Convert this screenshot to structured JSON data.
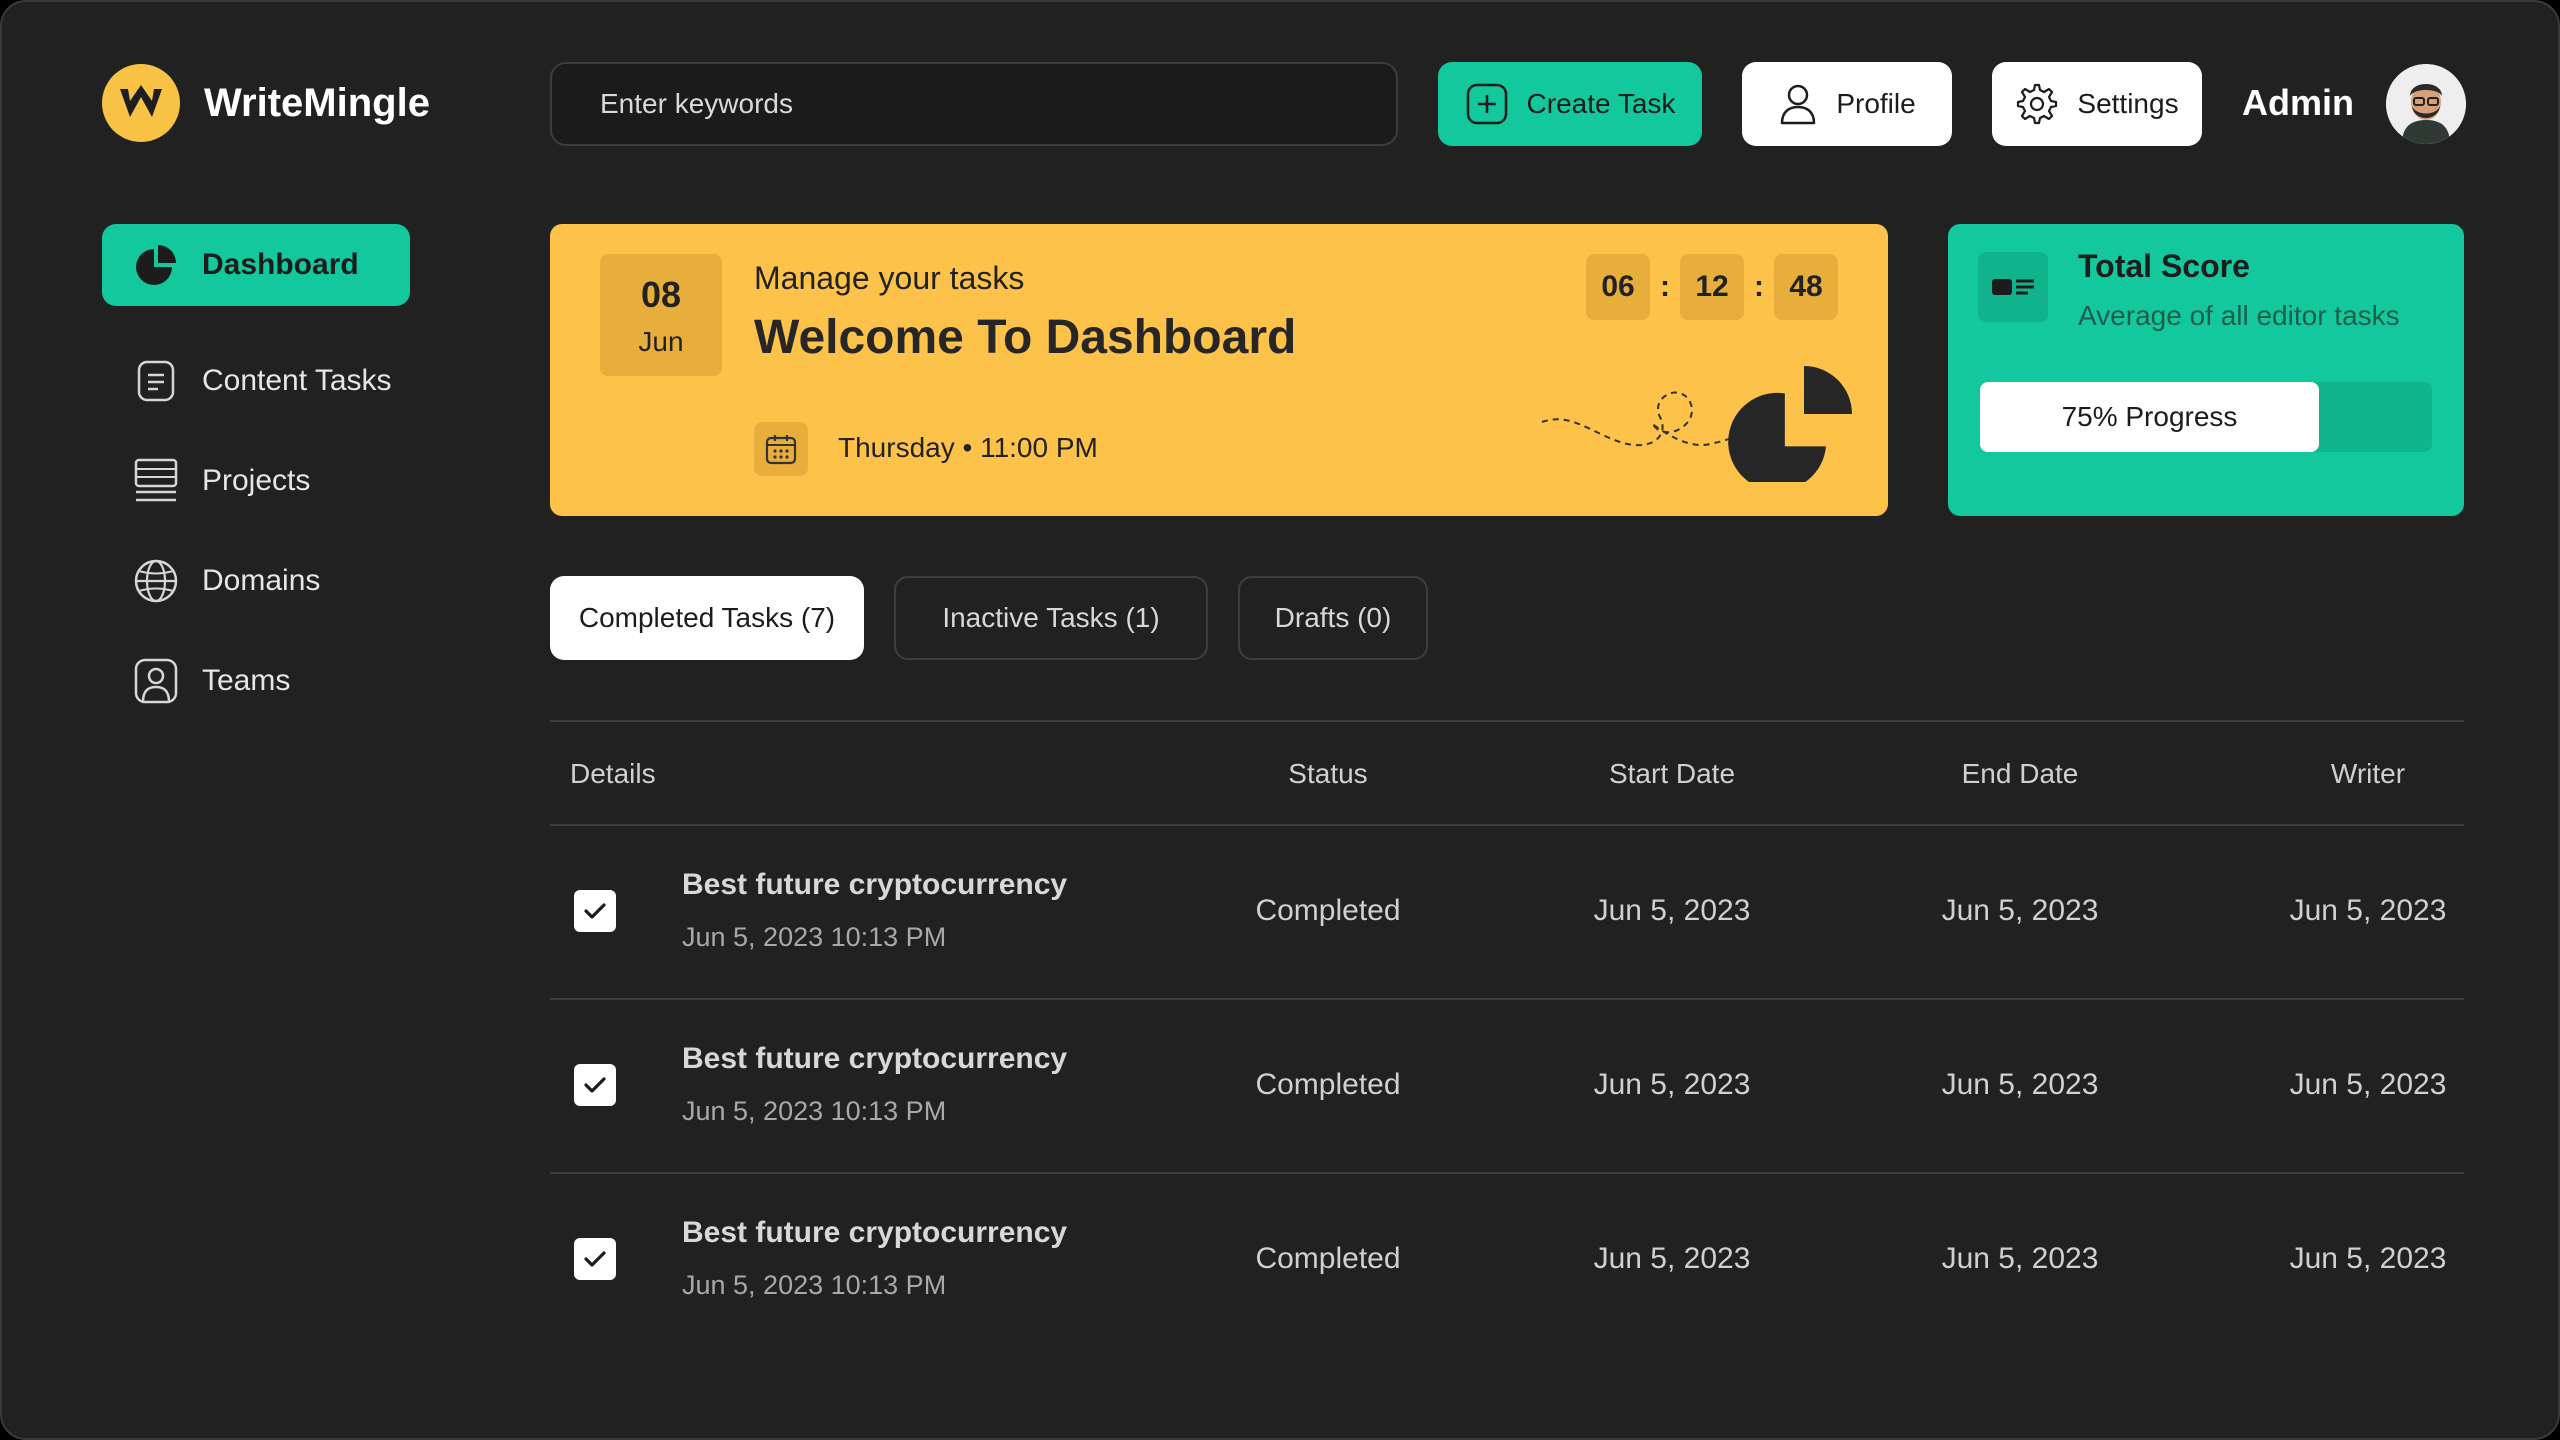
{
  "app": {
    "name": "WriteMingle"
  },
  "search": {
    "placeholder": "Enter keywords"
  },
  "header": {
    "create_label": "Create Task",
    "profile_label": "Profile",
    "settings_label": "Settings",
    "user_name": "Admin"
  },
  "sidebar": {
    "items": [
      {
        "label": "Dashboard",
        "icon": "pie-chart-icon",
        "active": true
      },
      {
        "label": "Content Tasks",
        "icon": "document-icon"
      },
      {
        "label": "Projects",
        "icon": "list-icon"
      },
      {
        "label": "Domains",
        "icon": "globe-icon"
      },
      {
        "label": "Teams",
        "icon": "person-icon"
      }
    ]
  },
  "welcome": {
    "day": "08",
    "month": "Jun",
    "subtitle": "Manage your tasks",
    "title": "Welcome To Dashboard",
    "datetime": "Thursday • 11:00 PM",
    "timer": {
      "h": "06",
      "m": "12",
      "s": "48"
    }
  },
  "score": {
    "title": "Total Score",
    "subtitle": "Average of all editor tasks",
    "progress_label": "75% Progress",
    "progress": 0.75
  },
  "tabs": [
    {
      "label": "Completed Tasks (7)",
      "active": true
    },
    {
      "label": "Inactive Tasks (1)"
    },
    {
      "label": "Drafts (0)"
    }
  ],
  "table": {
    "headers": [
      "Details",
      "Status",
      "Start Date",
      "End Date",
      "Writer"
    ],
    "rows": [
      {
        "title": "Best future cryptocurrency",
        "timestamp": "Jun 5, 2023 10:13 PM",
        "status": "Completed",
        "start": "Jun 5, 2023",
        "end": "Jun 5, 2023",
        "writer": "Jun 5, 2023",
        "checked": true
      },
      {
        "title": "Best future cryptocurrency",
        "timestamp": "Jun 5, 2023 10:13 PM",
        "status": "Completed",
        "start": "Jun 5, 2023",
        "end": "Jun 5, 2023",
        "writer": "Jun 5, 2023",
        "checked": true
      },
      {
        "title": "Best future cryptocurrency",
        "timestamp": "Jun 5, 2023 10:13 PM",
        "status": "Completed",
        "start": "Jun 5, 2023",
        "end": "Jun 5, 2023",
        "writer": "Jun 5, 2023",
        "checked": true
      }
    ]
  },
  "colors": {
    "background": "#212121",
    "accent_green": "#12c89c",
    "accent_yellow": "#fcc24a",
    "text_primary": "#ffffff",
    "text_muted": "#a8a8a8"
  }
}
